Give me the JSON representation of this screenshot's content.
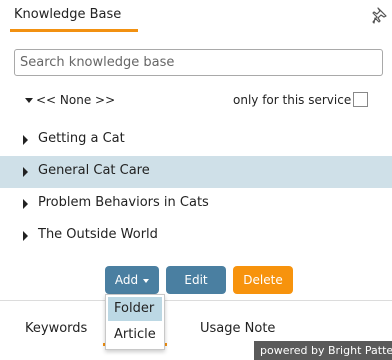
{
  "header": {
    "tab_label": "Knowledge Base",
    "pin_icon": "pin-icon"
  },
  "search": {
    "placeholder": "Search knowledge base",
    "value": ""
  },
  "filter": {
    "scope_label": "<< None >>",
    "only_service_label": "only for this service",
    "only_service_checked": false
  },
  "tree": {
    "items": [
      {
        "label": "Getting a Cat",
        "selected": false
      },
      {
        "label": "General Cat Care",
        "selected": true
      },
      {
        "label": "Problem Behaviors in Cats",
        "selected": false
      },
      {
        "label": "The Outside World",
        "selected": false
      }
    ]
  },
  "toolbar": {
    "add_label": "Add",
    "edit_label": "Edit",
    "delete_label": "Delete"
  },
  "add_menu": {
    "options": [
      {
        "label": "Folder",
        "highlighted": true
      },
      {
        "label": "Article",
        "highlighted": false
      }
    ]
  },
  "bottom_tabs": {
    "keywords_label": "Keywords",
    "usage_label": "Usage Note"
  },
  "footer": {
    "powered_by": "powered by Bright Pattern"
  },
  "colors": {
    "accent": "#f29111",
    "button_blue": "#4a7fa1",
    "delete_orange": "#f7930d",
    "selection": "#cfe0e8"
  }
}
